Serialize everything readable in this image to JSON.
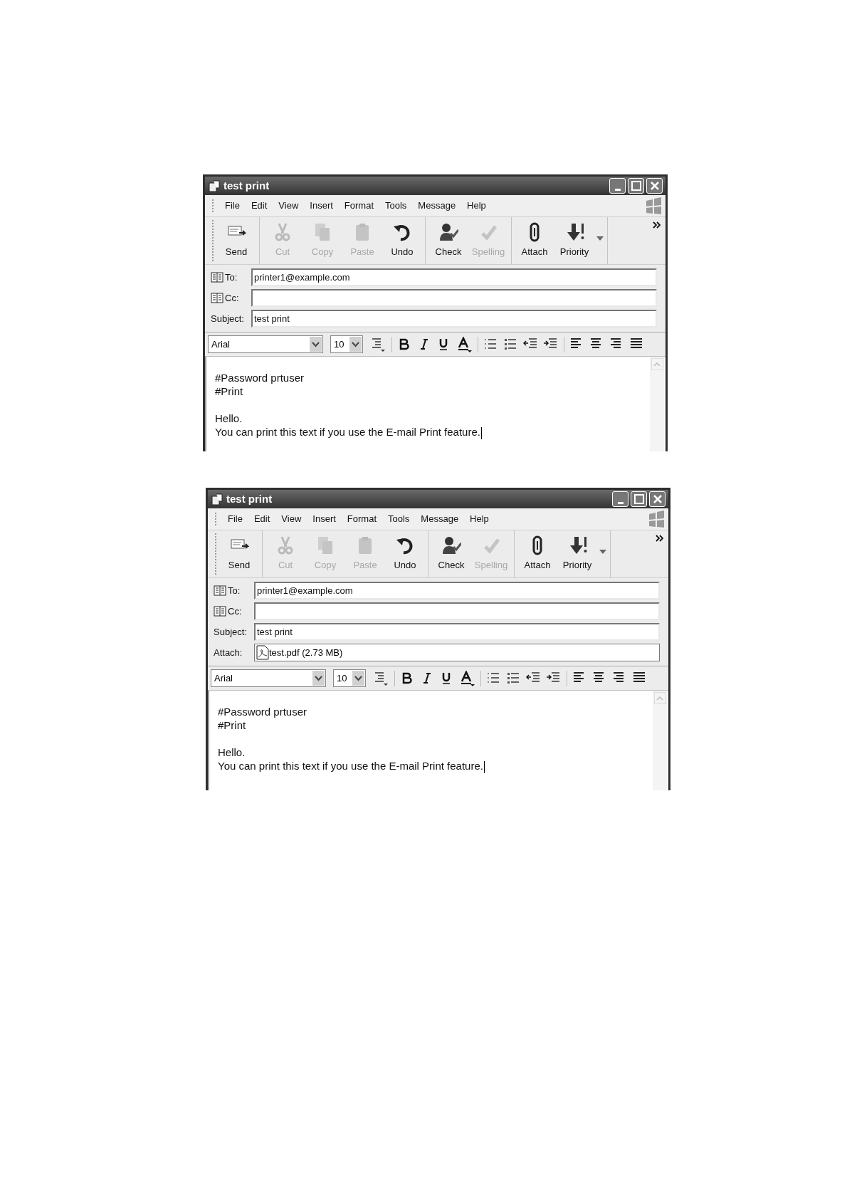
{
  "windows": [
    {
      "title": "test print",
      "menu": [
        "File",
        "Edit",
        "View",
        "Insert",
        "Format",
        "Tools",
        "Message",
        "Help"
      ],
      "toolbar_groups": [
        [
          {
            "label": "Send",
            "disabled": false
          }
        ],
        [
          {
            "label": "Cut",
            "disabled": true
          },
          {
            "label": "Copy",
            "disabled": true
          },
          {
            "label": "Paste",
            "disabled": true
          },
          {
            "label": "Undo",
            "disabled": false
          }
        ],
        [
          {
            "label": "Check",
            "disabled": false
          },
          {
            "label": "Spelling",
            "disabled": true
          }
        ],
        [
          {
            "label": "Attach",
            "disabled": false
          },
          {
            "label": "Priority",
            "disabled": false
          }
        ]
      ],
      "fields": [
        {
          "kind": "address",
          "label": "To:",
          "value": "printer1@example.com"
        },
        {
          "kind": "address",
          "label": "Cc:"
        },
        {
          "kind": "plain",
          "label": "Subject:",
          "value": "test print"
        }
      ],
      "format_bar": {
        "font": "Arial",
        "size": "10"
      },
      "body": [
        [
          "#Password prtuser",
          "#Print"
        ],
        [
          "Hello.",
          "You can print this text if you use the E-mail Print feature."
        ]
      ]
    },
    {
      "title": "test print",
      "menu": [
        "File",
        "Edit",
        "View",
        "Insert",
        "Format",
        "Tools",
        "Message",
        "Help"
      ],
      "toolbar_groups": [
        [
          {
            "label": "Send",
            "disabled": false
          }
        ],
        [
          {
            "label": "Cut",
            "disabled": true
          },
          {
            "label": "Copy",
            "disabled": true
          },
          {
            "label": "Paste",
            "disabled": true
          },
          {
            "label": "Undo",
            "disabled": false
          }
        ],
        [
          {
            "label": "Check",
            "disabled": false
          },
          {
            "label": "Spelling",
            "disabled": true
          }
        ],
        [
          {
            "label": "Attach",
            "disabled": false
          },
          {
            "label": "Priority",
            "disabled": false
          }
        ]
      ],
      "fields": [
        {
          "kind": "address",
          "label": "To:",
          "value": "printer1@example.com"
        },
        {
          "kind": "address",
          "label": "Cc:"
        },
        {
          "kind": "plain",
          "label": "Subject:",
          "value": "test print"
        },
        {
          "kind": "attachment",
          "label": "Attach:",
          "value": "test.pdf (2.73 MB)"
        }
      ],
      "format_bar": {
        "font": "Arial",
        "size": "10"
      },
      "body": [
        [
          "#Password prtuser",
          "#Print"
        ],
        [
          "Hello.",
          "You can print this text if you use the E-mail Print feature."
        ]
      ]
    }
  ]
}
